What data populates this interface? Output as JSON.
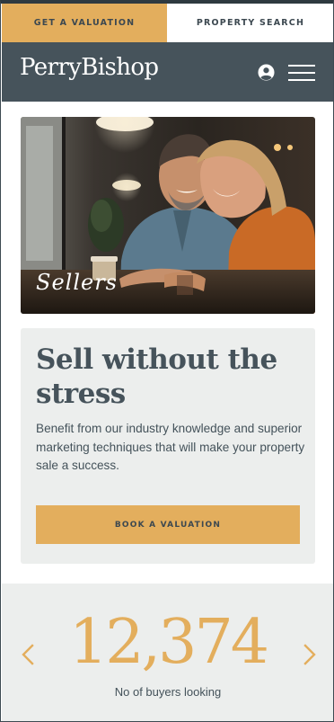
{
  "top_tabs": {
    "valuation_label": "GET A VALUATION",
    "search_label": "PROPERTY SEARCH"
  },
  "header": {
    "logo_text": "PerryBishop",
    "account_icon": "user-circle-icon",
    "menu_icon": "hamburger-menu-icon"
  },
  "hero": {
    "label": "Sellers"
  },
  "card": {
    "title": "Sell without the stress",
    "body": "Benefit from our industry knowledge and superior marketing techniques that will make your property sale a success.",
    "button_label": "BOOK A VALUATION"
  },
  "stats": {
    "value": "12,374",
    "label": "No of buyers looking",
    "prev_icon": "chevron-left-icon",
    "next_icon": "chevron-right-icon"
  },
  "colors": {
    "accent_gold": "#e3ae5d",
    "header_slate": "#46535b",
    "panel_grey": "#eceeed",
    "text_dark": "#44525a"
  }
}
